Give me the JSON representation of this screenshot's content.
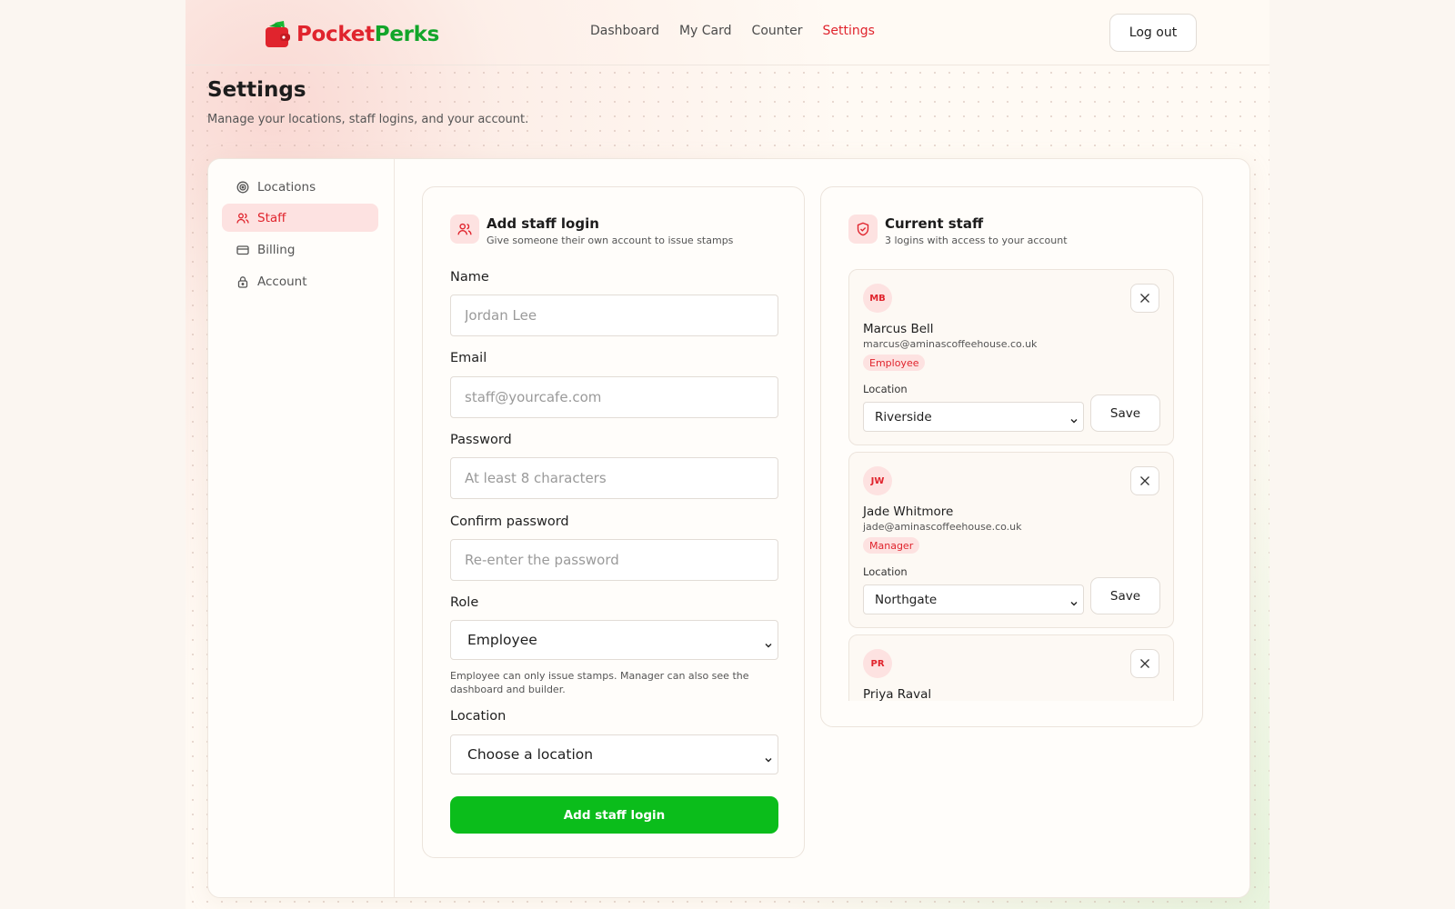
{
  "brand": {
    "name_part1": "Pocket",
    "name_part2": "Perks",
    "red": "#e0242d",
    "green": "#12a52a"
  },
  "nav": {
    "items": [
      {
        "label": "Dashboard",
        "active": false
      },
      {
        "label": "My Card",
        "active": false
      },
      {
        "label": "Counter",
        "active": false
      },
      {
        "label": "Settings",
        "active": true
      }
    ],
    "logout_label": "Log out"
  },
  "page": {
    "title": "Settings",
    "subtitle": "Manage your locations, staff logins, and your account."
  },
  "sidebar": {
    "items": [
      {
        "label": "Locations",
        "icon": "target-icon",
        "active": false
      },
      {
        "label": "Staff",
        "icon": "users-icon",
        "active": true
      },
      {
        "label": "Billing",
        "icon": "credit-card-icon",
        "active": false
      },
      {
        "label": "Account",
        "icon": "lock-icon",
        "active": false
      }
    ]
  },
  "add_staff": {
    "title": "Add staff login",
    "subtitle": "Give someone their own account to issue stamps",
    "icon": "users-icon",
    "fields": {
      "name": {
        "label": "Name",
        "placeholder": "Jordan Lee"
      },
      "email": {
        "label": "Email",
        "placeholder": "staff@yourcafe.com"
      },
      "password": {
        "label": "Password",
        "placeholder": "At least 8 characters"
      },
      "confirm": {
        "label": "Confirm password",
        "placeholder": "Re-enter the password"
      },
      "role": {
        "label": "Role",
        "value": "Employee"
      },
      "location": {
        "label": "Location",
        "value": "Choose a location"
      }
    },
    "role_hint": "Employee can only issue stamps. Manager can also see the dashboard and builder.",
    "submit_label": "Add staff login",
    "submit_color": "#0bbd1b"
  },
  "current_staff": {
    "title": "Current staff",
    "subtitle": "3 logins with access to your account",
    "icon": "shield-check-icon",
    "location_label": "Location",
    "save_label": "Save",
    "members": [
      {
        "initials": "MB",
        "name": "Marcus Bell",
        "email": "marcus@aminascoffeehouse.co.uk",
        "role": "Employee",
        "location": "Riverside"
      },
      {
        "initials": "JW",
        "name": "Jade Whitmore",
        "email": "jade@aminascoffeehouse.co.uk",
        "role": "Manager",
        "location": "Northgate"
      },
      {
        "initials": "PR",
        "name": "Priya Raval"
      }
    ]
  }
}
